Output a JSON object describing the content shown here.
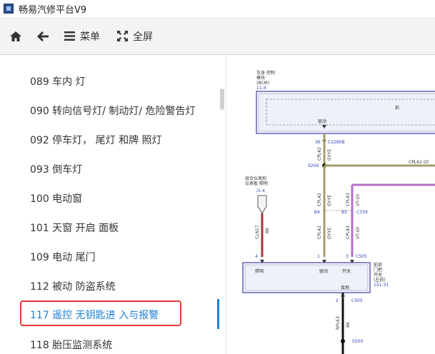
{
  "window": {
    "title": "畅易汽修平台V9"
  },
  "toolbar": {
    "menu_label": "菜单",
    "fullscreen_label": "全屏"
  },
  "sidebar": {
    "fragment": "   ",
    "items": [
      {
        "label": "089 车内 灯"
      },
      {
        "label": "090 转向信号灯/ 制动灯/ 危险警告灯"
      },
      {
        "label": "092 停车灯， 尾灯 和牌 照灯"
      },
      {
        "label": "093 倒车灯"
      },
      {
        "label": "100 电动窗"
      },
      {
        "label": "101 天窗 开启 面板"
      },
      {
        "label": "109 电动 尾门"
      },
      {
        "label": "112 被动 防盗系统"
      },
      {
        "label": "117 遥控 无钥匙进 入与报警"
      },
      {
        "label": "118 胎压监测系统"
      }
    ]
  },
  "diagram": {
    "bcm_label_1": "车身 控制",
    "bcm_label_2": "模块",
    "bcm_label_3": "(BCM)",
    "bcm_ref": "11-4",
    "bcm_pin_label": "驱动",
    "bcm_right_label": "前",
    "pin_36": "36",
    "conn_c2280b": "C2280B",
    "wire_cpl42_a": "CPL42",
    "wire_gyye_a": "GY-YE",
    "splice_s204": "S204",
    "horiz_wire": "CPL42  GY",
    "cluster_label_1": "组合仪表和",
    "cluster_label_2": "仪表板 照明",
    "cluster_ref": "/1-4",
    "wire_cln17": "CLN17",
    "wire_bk_a": "BK",
    "wire_cpl42_b": "CPL42",
    "wire_gyye_b": "GY-YE",
    "wire_cpl43_a": "CPL43",
    "wire_vtgy_a": "VT-GY",
    "pin_b4": "B4",
    "pin_b5": "B5",
    "conn_c339": "C339",
    "wire_cpl42_c": "CPL42",
    "wire_gyye_c": "GY-YE",
    "wire_cpl43_b": "CPL43",
    "wire_vtgy_b": "VT-GY",
    "pin_4": "4",
    "pin_1": "1",
    "pin_3": "3",
    "conn_c505a": "C505",
    "module_lbl_left": "照明",
    "module_lbl_mid": "驱动",
    "module_lbl_right": "开关",
    "module_name_1": "前部",
    "module_name_2": "门把",
    "module_name_3": "开关",
    "module_name_4": "(左前)",
    "module_ref": "151-31",
    "module_ground": "接地",
    "pin_2": "2",
    "conn_c505b": "C505",
    "wire_rpl63": "RPL63",
    "wire_bk_b": "BK",
    "splice_s500": "S500"
  }
}
